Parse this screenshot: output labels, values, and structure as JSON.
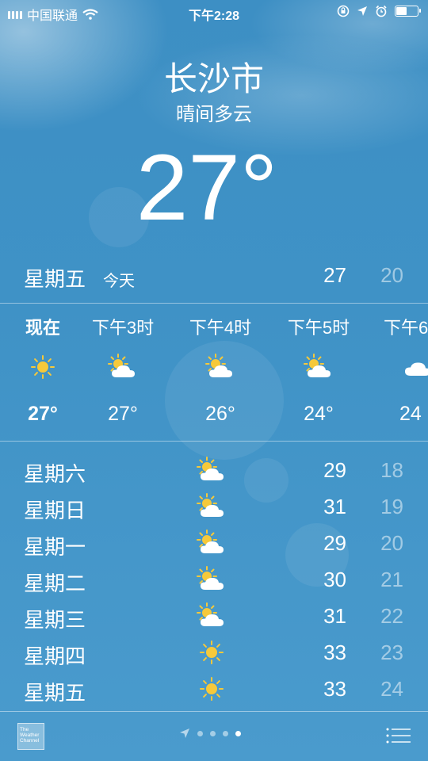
{
  "status_bar": {
    "carrier": "中国联通",
    "time": "下午2:28",
    "battery_level": 0.55,
    "icons": [
      "signal-icon",
      "wifi-icon",
      "orientation-lock-icon",
      "location-icon",
      "alarm-icon",
      "battery-icon"
    ]
  },
  "header": {
    "city": "长沙市",
    "condition": "晴间多云",
    "temperature": "27°"
  },
  "today": {
    "day": "星期五",
    "tag": "今天",
    "high": "27",
    "low": "20"
  },
  "hourly": [
    {
      "label": "现在",
      "icon": "sun-icon",
      "temp": "27°"
    },
    {
      "label": "下午3时",
      "icon": "partly-cloudy-icon",
      "temp": "27°"
    },
    {
      "label": "下午4时",
      "icon": "partly-cloudy-icon",
      "temp": "26°"
    },
    {
      "label": "下午5时",
      "icon": "partly-cloudy-icon",
      "temp": "24°"
    },
    {
      "label": "下午6",
      "icon": "cloud-icon",
      "temp": "24"
    }
  ],
  "daily": [
    {
      "day": "星期六",
      "icon": "partly-cloudy-icon",
      "high": "29",
      "low": "18"
    },
    {
      "day": "星期日",
      "icon": "partly-cloudy-icon",
      "high": "31",
      "low": "19"
    },
    {
      "day": "星期一",
      "icon": "partly-cloudy-icon",
      "high": "29",
      "low": "20"
    },
    {
      "day": "星期二",
      "icon": "partly-cloudy-icon",
      "high": "30",
      "low": "21"
    },
    {
      "day": "星期三",
      "icon": "partly-cloudy-icon",
      "high": "31",
      "low": "22"
    },
    {
      "day": "星期四",
      "icon": "sun-icon",
      "high": "33",
      "low": "23"
    },
    {
      "day": "星期五",
      "icon": "sun-icon",
      "high": "33",
      "low": "24"
    }
  ],
  "bottom_bar": {
    "logo_text": "The Weather Channel",
    "page_count": 4,
    "active_page": 4
  },
  "colors": {
    "sky": "#3f92c6",
    "sun": "#f6c93a",
    "cloud": "#ffffff"
  }
}
